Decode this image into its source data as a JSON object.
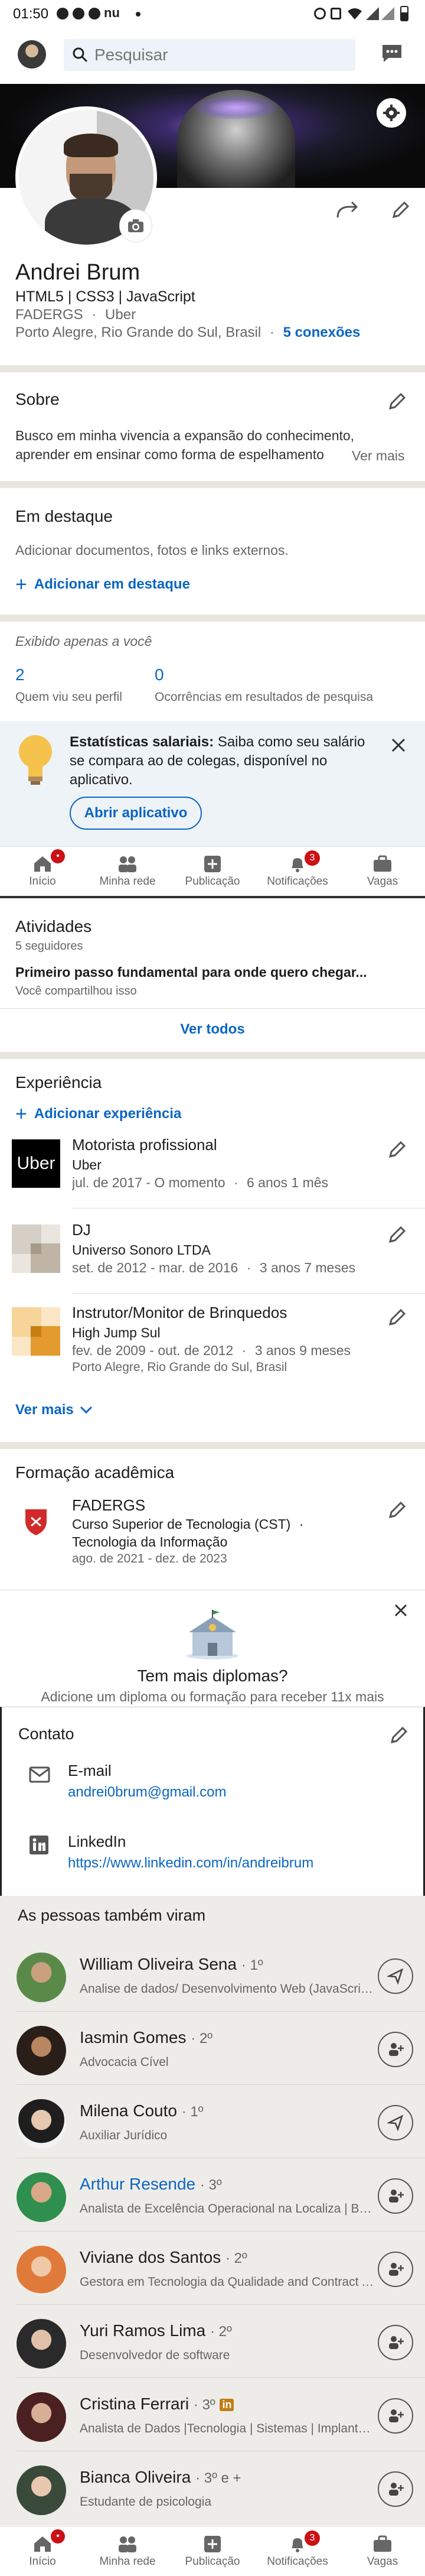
{
  "status_bar": {
    "time": "01:50",
    "nu": "nu"
  },
  "search": {
    "placeholder": "Pesquisar"
  },
  "profile": {
    "name": "Andrei Brum",
    "headline": "HTML5 | CSS3 | JavaScript",
    "education_short": "FADERGS",
    "company_short": "Uber",
    "location": "Porto Alegre, Rio Grande do Sul, Brasil",
    "connections": "5 conexões",
    "dot": "·"
  },
  "about": {
    "title": "Sobre",
    "text_line1": "Busco em minha vivencia a expansão do conhecimento,",
    "text_line2": "aprender em ensinar como forma de espelhamento",
    "see_more": "Ver mais"
  },
  "featured": {
    "title": "Em destaque",
    "description": "Adicionar documentos, fotos e links externos.",
    "add_label": "Adicionar em destaque"
  },
  "analytics": {
    "private_label": "Exibido apenas a você",
    "profile_views_count": "2",
    "profile_views_label": "Quem viu seu perfil",
    "search_count": "0",
    "search_label": "Ocorrências em resultados de pesquisa"
  },
  "salary_promo": {
    "bold": "Estatísticas salariais:",
    "line1_rest": " Saiba como seu salário",
    "line2": "se compara ao de colegas, disponível no",
    "line3": "aplicativo.",
    "button": "Abrir aplicativo"
  },
  "nav": {
    "items": [
      {
        "label": "Início",
        "icon": "home-icon",
        "badge": "•"
      },
      {
        "label": "Minha rede",
        "icon": "network-icon",
        "badge": ""
      },
      {
        "label": "Publicação",
        "icon": "post-icon",
        "badge": ""
      },
      {
        "label": "Notificações",
        "icon": "bell-icon",
        "badge": "3"
      },
      {
        "label": "Vagas",
        "icon": "briefcase-icon",
        "badge": ""
      }
    ]
  },
  "activity": {
    "title": "Atividades",
    "followers": "5 seguidores",
    "post_title": "Primeiro passo fundamental para onde quero chegar...",
    "post_meta": "Você compartilhou isso",
    "see_all": "Ver todos"
  },
  "experience": {
    "title": "Experiência",
    "add_label": "Adicionar experiência",
    "items": [
      {
        "title": "Motorista profissional",
        "company": "Uber",
        "dates": "jul. de 2017 - O momento",
        "duration": "6 anos 1 mês",
        "location": "",
        "logo": "uber"
      },
      {
        "title": "DJ",
        "company": "Universo Sonoro LTDA",
        "dates": "set. de 2012 - mar. de 2016",
        "duration": "3 anos 7 meses",
        "location": "",
        "logo": "gray"
      },
      {
        "title": "Instrutor/Monitor de Brinquedos",
        "company": "High Jump Sul",
        "dates": "fev. de 2009 - out. de 2012",
        "duration": "3 anos 9 meses",
        "location": "Porto Alegre, Rio Grande do Sul, Brasil",
        "logo": "orange"
      }
    ],
    "see_more": "Ver mais",
    "uber_logo_text": "Uber"
  },
  "education": {
    "title": "Formação acadêmica",
    "school": "FADERGS",
    "degree_line1": "Curso Superior de Tecnologia (CST)",
    "degree_line2": "Tecnologia da Informação",
    "dates": "ago. de 2021 - dez. de 2023",
    "promo_title": "Tem mais diplomas?",
    "promo_text": "Adicione um diploma ou formação para receber 11x mais"
  },
  "contact": {
    "title": "Contato",
    "email_label": "E-mail",
    "email_value": "andrei0brum@gmail.com",
    "linkedin_label": "LinkedIn",
    "linkedin_value": "https://www.linkedin.com/in/andreibrum"
  },
  "people": {
    "title": "As pessoas também viram",
    "items": [
      {
        "name": "William Oliveira Sena",
        "degree": "· 1º",
        "headline": "Analise de dados/ Desenvolvimento Web (JavaScrip...",
        "action": "send",
        "color": "#5a8a4a",
        "name_color": "#1d1d1d",
        "in_badge": false
      },
      {
        "name": "Iasmin Gomes",
        "degree": "· 2º",
        "headline": "Advocacia Cível",
        "action": "connect",
        "color": "#4a3a30",
        "name_color": "#1d1d1d",
        "in_badge": false
      },
      {
        "name": "Milena Couto",
        "degree": "· 1º",
        "headline": "Auxiliar Jurídico",
        "action": "send",
        "color": "#2a2a2a",
        "name_color": "#1d1d1d",
        "in_badge": false
      },
      {
        "name": "Arthur Resende",
        "degree": "· 3º",
        "headline": "Analista de Excelência Operacional na Localiza | Bac...",
        "action": "connect",
        "color": "#2f8f4e",
        "name_color": "#0a66c2",
        "in_badge": false
      },
      {
        "name": "Viviane dos Santos",
        "degree": "· 2º",
        "headline": "Gestora em Tecnologia da Qualidade and Contract A...",
        "action": "connect",
        "color": "#e07a3a",
        "name_color": "#1d1d1d",
        "in_badge": false
      },
      {
        "name": "Yuri Ramos Lima",
        "degree": "· 2º",
        "headline": "Desenvolvedor de software",
        "action": "connect",
        "color": "#3a3a3a",
        "name_color": "#1d1d1d",
        "in_badge": false
      },
      {
        "name": "Cristina Ferrari",
        "degree": "· 3º",
        "headline": "Analista de Dados |Tecnologia | Sistemas | Implanta...",
        "action": "connect",
        "color": "#5a2a2a",
        "name_color": "#1d1d1d",
        "in_badge": true
      },
      {
        "name": "Bianca Oliveira",
        "degree": "· 3º e +",
        "headline": "Estudante de psicologia",
        "action": "connect",
        "color": "#3a4a3a",
        "name_color": "#1d1d1d",
        "in_badge": false
      }
    ]
  },
  "in_badge_text": "in"
}
